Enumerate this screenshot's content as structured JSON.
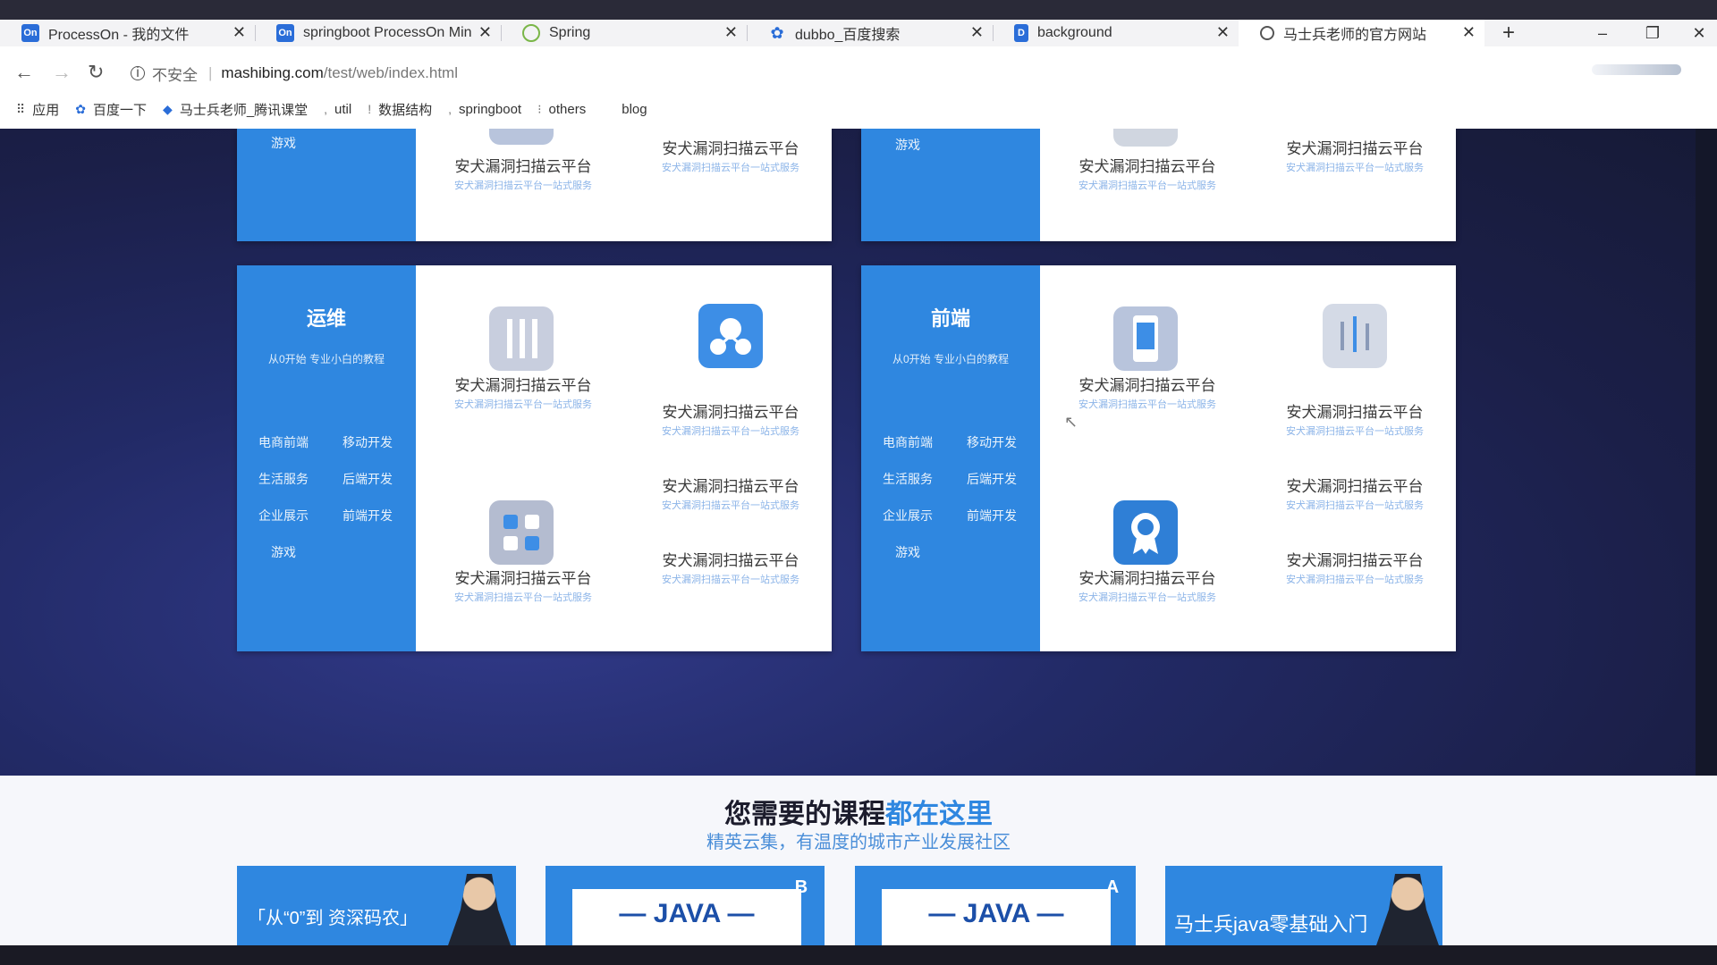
{
  "browser": {
    "tabs": [
      {
        "label": "ProcessOn - 我的文件",
        "icon": "On",
        "color": "#2a6dd8"
      },
      {
        "label": "springboot ProcessOn Min",
        "icon": "On",
        "color": "#2a6dd8"
      },
      {
        "label": "Spring",
        "icon": "spring-icon",
        "color": "#7ab648"
      },
      {
        "label": "dubbo_百度搜索",
        "icon": "baidu-paw-icon",
        "color": "#2a6dd8"
      },
      {
        "label": "background",
        "icon": "D",
        "color": "#2a6dd8"
      },
      {
        "label": "马士兵老师的官方网站",
        "icon": "globe-icon",
        "color": "#555555"
      }
    ],
    "address": {
      "insecure_label": "不安全",
      "domain": "mashibing.com",
      "path": "/test/web/index.html"
    },
    "bookmarks": [
      "应用",
      "百度一下",
      "马士兵老师_腾讯课堂",
      "util",
      "数据结构",
      "springboot",
      "others",
      "blog"
    ]
  },
  "sections": {
    "top_left_tag": "游戏",
    "top_right_tag": "游戏",
    "product_name": "安犬漏洞扫描云平台",
    "product_desc": "安犬漏洞扫描云平台一站式服务",
    "ops": {
      "title": "运维",
      "subtitle": "从0开始 专业小白的教程",
      "tags": [
        "电商前端",
        "移动开发",
        "生活服务",
        "后端开发",
        "企业展示",
        "前端开发",
        "游戏"
      ]
    },
    "frontend": {
      "title": "前端",
      "subtitle": "从0开始 专业小白的教程",
      "tags": [
        "电商前端",
        "移动开发",
        "生活服务",
        "后端开发",
        "企业展示",
        "前端开发",
        "游戏"
      ]
    }
  },
  "courses": {
    "title_dark": "您需要的课程",
    "title_highlight": "都在这里",
    "subtitle": "精英云集，有温度的城市产业发展社区",
    "items": [
      {
        "label": "「从“0”到 资深码农」"
      },
      {
        "label": "— JAVA —",
        "badge": "B"
      },
      {
        "label": "— JAVA —",
        "badge": "A"
      },
      {
        "label": "马士兵java零基础入门"
      }
    ]
  },
  "colors": {
    "accent": "#2f87e0",
    "page_bg": "#1b1f48",
    "card_bg": "#ffffff"
  }
}
